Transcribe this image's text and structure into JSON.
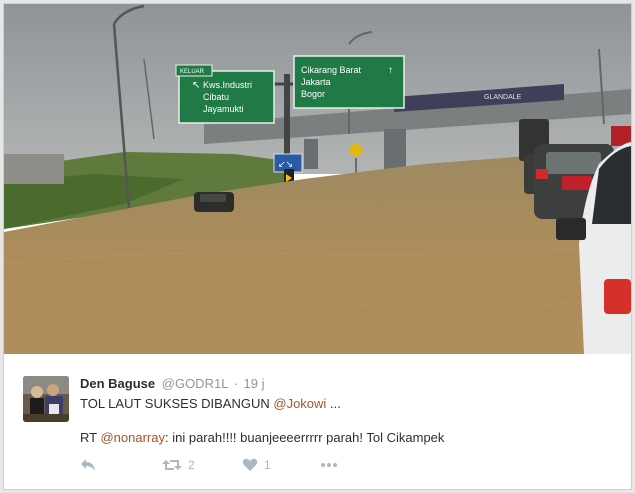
{
  "photo": {
    "signs": {
      "left_line1": "Kws.Industri",
      "left_line2": "Cibatu",
      "left_line3": "Jayamukti",
      "right_line1": "Cikarang Barat",
      "right_line2": "Jakarta",
      "right_line3": "Bogor",
      "small_top": "KELUAR",
      "bridge_text": "GLANDALE"
    }
  },
  "tweet": {
    "author_name": "Den Baguse",
    "author_handle": "@GODR1L",
    "separator": "·",
    "time": "19 j",
    "text_prefix": "TOL LAUT SUKSES DIBANGUN ",
    "text_mention": "@Jokowi",
    "text_suffix": " ...",
    "rt_prefix": "RT ",
    "rt_mention": "@nonarray",
    "rt_text": ": ini parah!!!! buanjeeeerrrrr parah! Tol Cikampek",
    "retweet_count": "2",
    "like_count": "1"
  },
  "icons": {
    "reply": "reply-icon",
    "retweet": "retweet-icon",
    "like": "heart-icon",
    "more": "more-dots-icon"
  },
  "colors": {
    "mention": "#a7552a",
    "muted": "#8899a6",
    "sign_green": "#1f7a45",
    "flood_water": "#a98a58"
  }
}
